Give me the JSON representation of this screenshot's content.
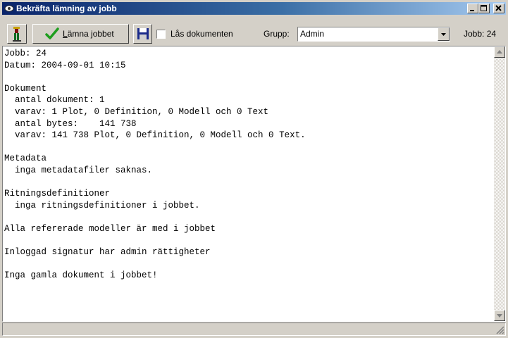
{
  "window": {
    "title": "Bekräfta lämning av jobb",
    "icon": "eye-icon",
    "controls": [
      "minimize-icon",
      "maximize-icon",
      "close-icon"
    ]
  },
  "toolbar": {
    "user_icon": "user-figure-icon",
    "submit_button": {
      "mnemonic": "L",
      "rest": "ämna jobbet",
      "icon": "checkmark-icon"
    },
    "save_icon": "floppy-disk-icon",
    "lock_checkbox": {
      "label": "Lås dokumenten",
      "checked": false
    },
    "group_label": "Grupp:",
    "group_value": "Admin",
    "job_label": "Jobb: 24"
  },
  "report": {
    "lines": [
      "Jobb: 24",
      "Datum: 2004-09-01 10:15",
      "",
      "Dokument",
      "  antal dokument: 1",
      "  varav: 1 Plot, 0 Definition, 0 Modell och 0 Text",
      "  antal bytes:    141 738",
      "  varav: 141 738 Plot, 0 Definition, 0 Modell och 0 Text.",
      "",
      "Metadata",
      "  inga metadatafiler saknas.",
      "",
      "Ritningsdefinitioner",
      "  inga ritningsdefinitioner i jobbet.",
      "",
      "Alla refererade modeller är med i jobbet",
      "",
      "Inloggad signatur har admin rättigheter",
      "",
      "Inga gamla dokument i jobbet!"
    ]
  },
  "colors": {
    "titlebar_start": "#0a246a",
    "titlebar_end": "#a6caf0",
    "face": "#d4d0c8",
    "check_green": "#1e9e1e"
  }
}
